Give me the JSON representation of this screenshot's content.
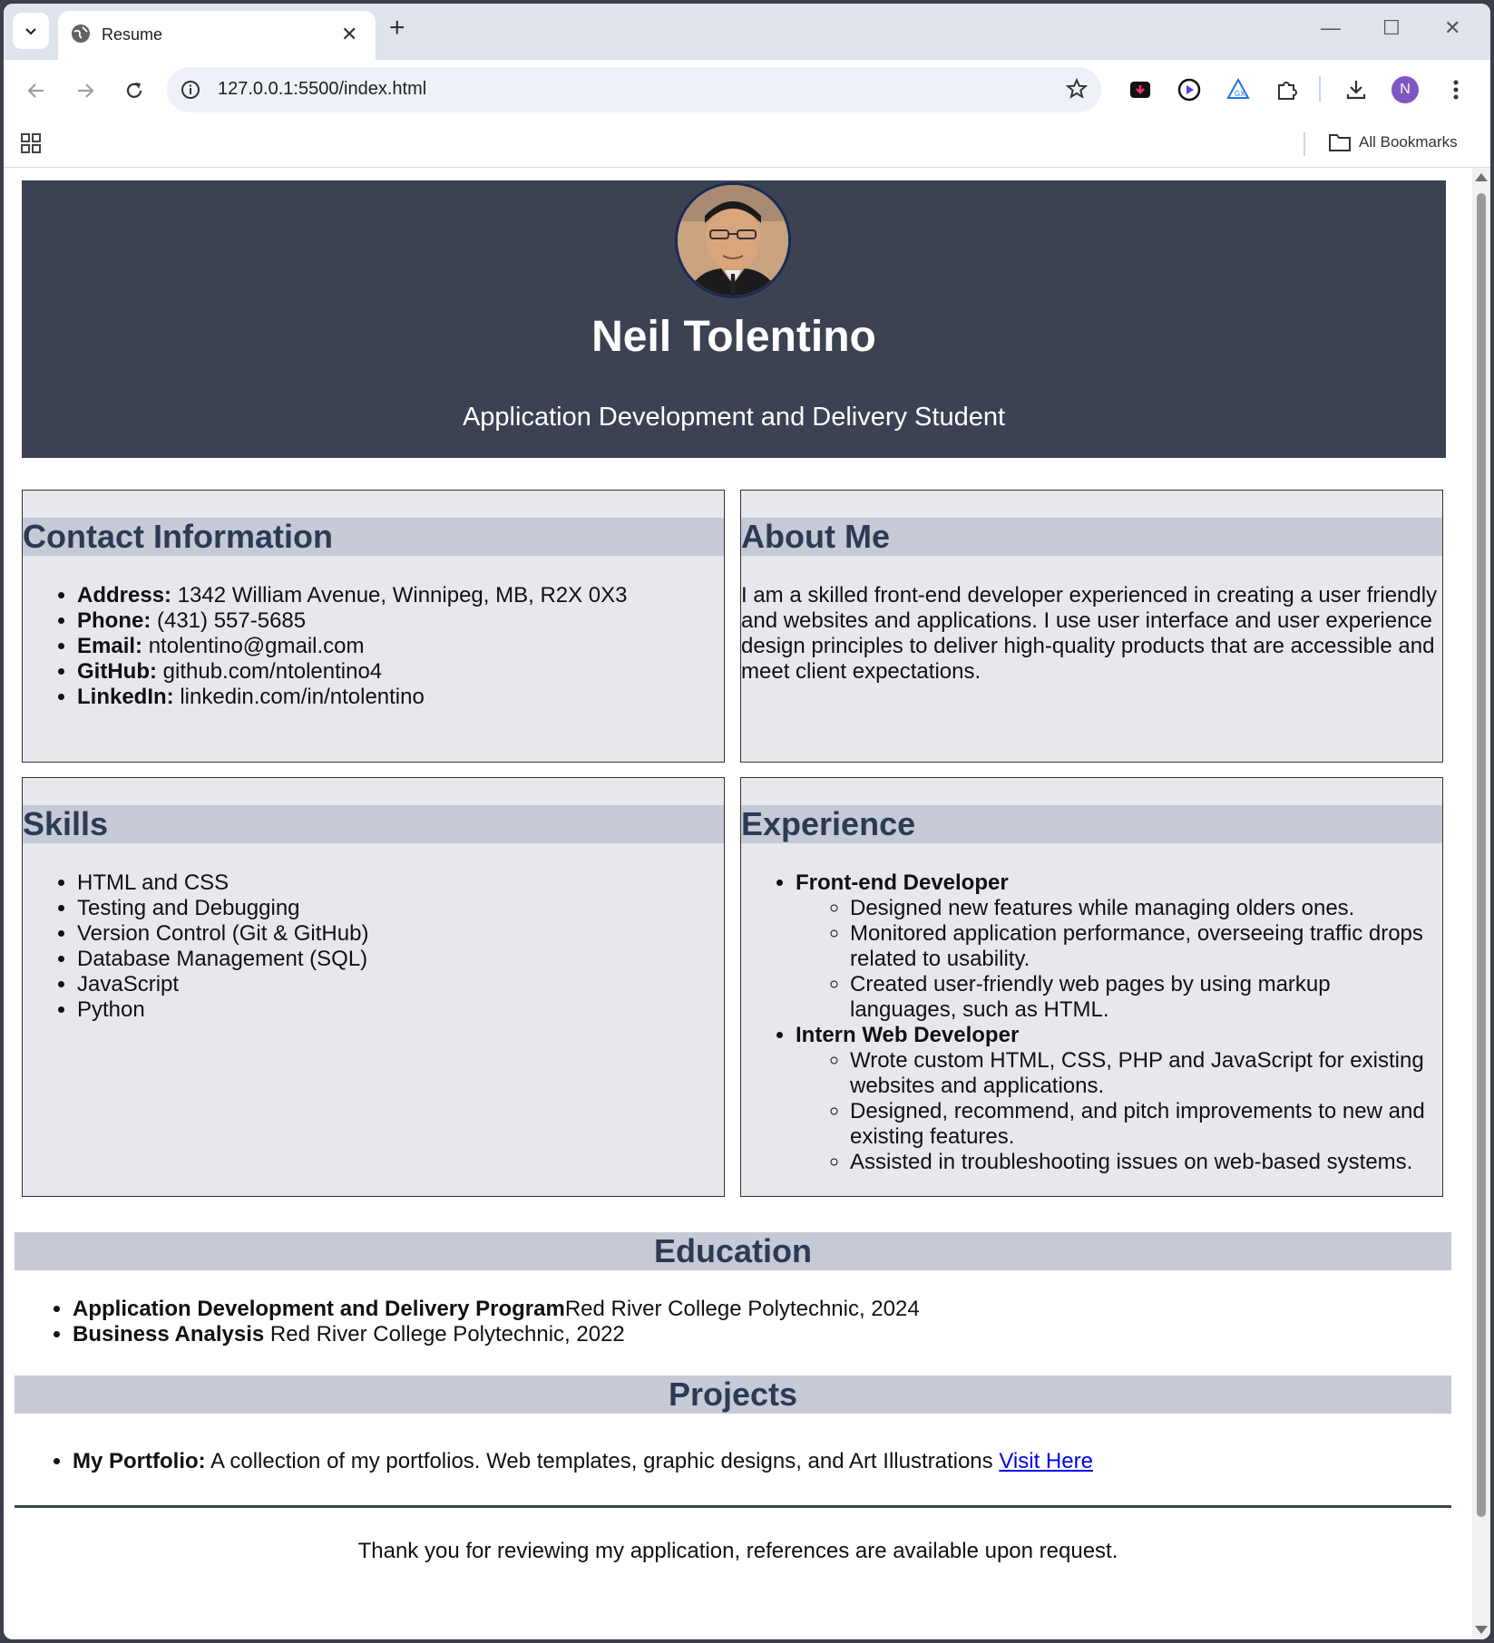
{
  "browser": {
    "tab_title": "Resume",
    "url": "127.0.0.1:5500/index.html",
    "all_bookmarks": "All Bookmarks",
    "profile_initial": "N"
  },
  "header": {
    "name": "Neil Tolentino",
    "title": "Application Development and Delivery Student"
  },
  "contact": {
    "heading": "Contact Information",
    "items": [
      {
        "label": "Address:",
        "value": " 1342 William Avenue, Winnipeg, MB, R2X 0X3"
      },
      {
        "label": "Phone:",
        "value": " (431) 557-5685"
      },
      {
        "label": "Email:",
        "value": " ntolentino@gmail.com"
      },
      {
        "label": "GitHub:",
        "value": " github.com/ntolentino4"
      },
      {
        "label": "LinkedIn:",
        "value": " linkedin.com/in/ntolentino"
      }
    ]
  },
  "about": {
    "heading": "About Me",
    "text": "I am a skilled front-end developer experienced in creating a user friendly and websites and applications. I use user interface and user experience design principles to deliver high-quality products that are accessible and meet client expectations."
  },
  "skills": {
    "heading": "Skills",
    "items": [
      "HTML and CSS",
      "Testing and Debugging",
      "Version Control (Git & GitHub)",
      "Database Management (SQL)",
      "JavaScript",
      "Python"
    ]
  },
  "experience": {
    "heading": "Experience",
    "jobs": [
      {
        "role": "Front-end Developer",
        "duties": [
          "Designed new features while managing olders ones.",
          "Monitored application performance, overseeing traffic drops related to usability.",
          "Created user-friendly web pages by using markup languages, such as HTML."
        ]
      },
      {
        "role": "Intern Web Developer",
        "duties": [
          "Wrote custom HTML, CSS, PHP and JavaScript for existing websites and applications.",
          "Designed, recommend, and pitch improvements to new and existing features.",
          "Assisted in troubleshooting issues on web-based systems."
        ]
      }
    ]
  },
  "education": {
    "heading": "Education",
    "items": [
      {
        "program": "Application Development and Delivery Program",
        "detail": "Red River College Polytechnic, 2024"
      },
      {
        "program": "Business Analysis",
        "detail": " Red River College Polytechnic, 2022"
      }
    ]
  },
  "projects": {
    "heading": "Projects",
    "items": [
      {
        "name": "My Portfolio:",
        "description": " A collection of my portfolios. Web templates, graphic designs, and Art Illustrations ",
        "link_text": "Visit Here"
      }
    ]
  },
  "footer": {
    "text": "Thank you for reviewing my application, references are available upon request."
  }
}
